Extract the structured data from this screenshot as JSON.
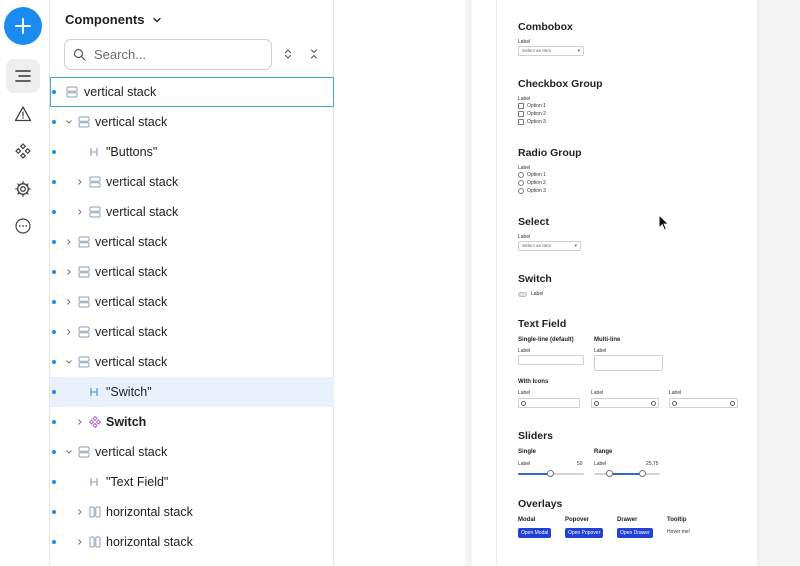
{
  "sidebar": {
    "actions": [
      "add",
      "layers",
      "warnings",
      "components",
      "settings",
      "more"
    ]
  },
  "panel": {
    "title": "Components",
    "search_placeholder": "Search...",
    "rows": [
      {
        "label": "vertical stack",
        "icon": "vstack-icon",
        "bold": false
      },
      {
        "label": "vertical stack",
        "icon": "vstack-icon",
        "bold": false
      },
      {
        "label": "\"Buttons\"",
        "icon": "text-icon",
        "bold": false
      },
      {
        "label": "vertical stack",
        "icon": "vstack-icon",
        "bold": false
      },
      {
        "label": "vertical stack",
        "icon": "vstack-icon",
        "bold": false
      },
      {
        "label": "vertical stack",
        "icon": "vstack-icon",
        "bold": false
      },
      {
        "label": "vertical stack",
        "icon": "vstack-icon",
        "bold": false
      },
      {
        "label": "vertical stack",
        "icon": "vstack-icon",
        "bold": false
      },
      {
        "label": "vertical stack",
        "icon": "vstack-icon",
        "bold": false
      },
      {
        "label": "vertical stack",
        "icon": "vstack-icon",
        "bold": false
      },
      {
        "label": "\"Switch\"",
        "icon": "text-icon",
        "bold": false
      },
      {
        "label": "Switch",
        "icon": "component-icon",
        "bold": true
      },
      {
        "label": "vertical stack",
        "icon": "vstack-icon",
        "bold": false
      },
      {
        "label": "\"Text Field\"",
        "icon": "text-icon",
        "bold": false
      },
      {
        "label": "horizontal stack",
        "icon": "hstack-icon",
        "bold": false
      },
      {
        "label": "horizontal stack",
        "icon": "hstack-icon",
        "bold": false
      }
    ]
  },
  "preview": {
    "combobox": {
      "title": "Combobox",
      "label": "Label",
      "placeholder": "Select an item"
    },
    "checkbox_group": {
      "title": "Checkbox Group",
      "label": "Label",
      "options": [
        "Option 1",
        "Option 2",
        "Option 3"
      ]
    },
    "radio_group": {
      "title": "Radio Group",
      "label": "Label",
      "options": [
        "Option 1",
        "Option 2",
        "Option 3"
      ]
    },
    "select": {
      "title": "Select",
      "label": "Label",
      "placeholder": "Select an item"
    },
    "switch": {
      "title": "Switch",
      "label": "Label"
    },
    "text_field": {
      "title": "Text Field",
      "single_line": "Single-line (default)",
      "multi_line": "Multi-line",
      "field_label": "Label",
      "with_icons": "With Icons"
    },
    "sliders": {
      "title": "Sliders",
      "single": "Single",
      "range": "Range",
      "label": "Label",
      "single_value": "50",
      "range_value": "25,75"
    },
    "overlays": {
      "title": "Overlays",
      "modal": "Modal",
      "popover": "Popover",
      "drawer": "Drawer",
      "tooltip": "Tooltip",
      "open_modal": "Open Modal",
      "open_popover": "Open Popover",
      "open_drawer": "Open Drawer",
      "hover": "Hover me!"
    }
  },
  "colors": {
    "accent": "#1a8cf0",
    "selection_border": "#3ea6e6",
    "highlight_row": "#e9f2fc",
    "overlay_button": "#2441d6",
    "slider_fill": "#2a6ad1"
  }
}
